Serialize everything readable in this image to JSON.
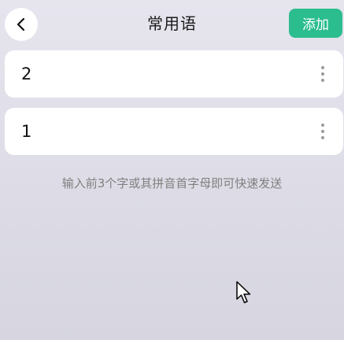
{
  "header": {
    "title": "常用语",
    "add_label": "添加",
    "back_icon": "chevron-left-icon"
  },
  "phrases": [
    {
      "text": "2"
    },
    {
      "text": "1"
    }
  ],
  "hint": "输入前3个字或其拼音首字母即可快速发送",
  "colors": {
    "accent": "#2bbd8e",
    "background": "#e1e0ea",
    "card": "#ffffff",
    "hint_text": "#808080"
  }
}
